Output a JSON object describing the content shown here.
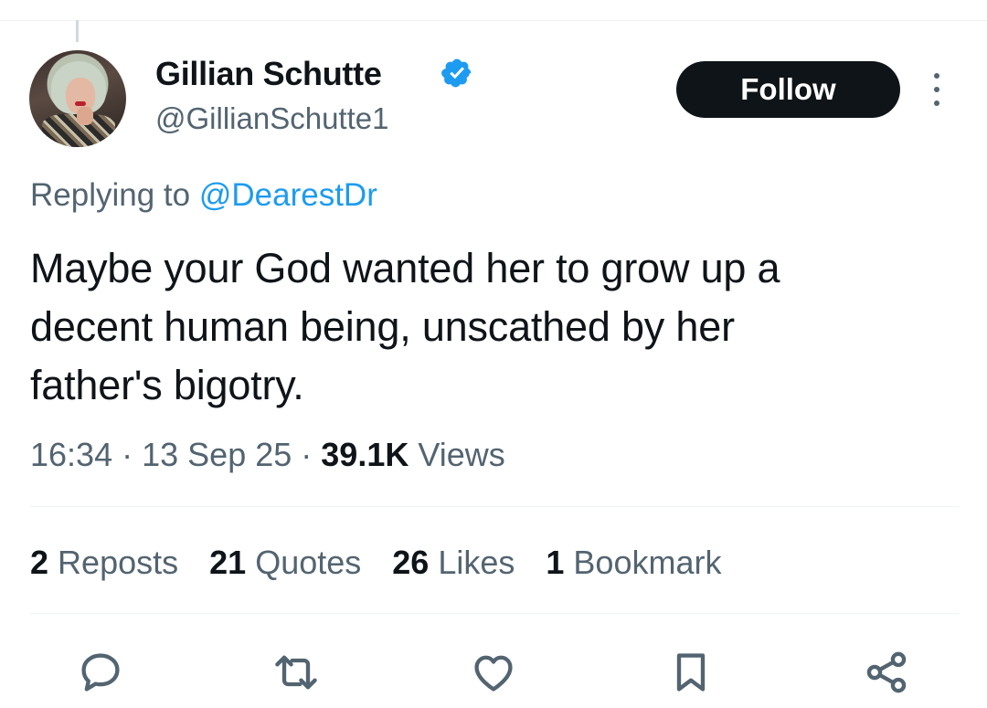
{
  "author": {
    "display_name": "Gillian Schutte",
    "handle": "@GillianSchutte1",
    "verified": true
  },
  "follow_label": "Follow",
  "reply_context": {
    "prefix": "Replying to",
    "mention": "@DearestDr"
  },
  "tweet": {
    "lines": [
      "Maybe your God wanted her to grow up a",
      "decent human being, unscathed by her",
      "father's bigotry."
    ],
    "time": "16:34",
    "date": "13 Sep 25",
    "views_count": "39.1K",
    "views_label": "Views"
  },
  "stats": {
    "reposts": {
      "count": "2",
      "label": "Reposts"
    },
    "quotes": {
      "count": "21",
      "label": "Quotes"
    },
    "likes": {
      "count": "26",
      "label": "Likes"
    },
    "bookmarks": {
      "count": "1",
      "label": "Bookmark"
    }
  },
  "icons": {
    "verified": "verified-badge-icon",
    "more": "more-options-icon",
    "reply": "reply-icon",
    "repost": "repost-icon",
    "like": "like-icon",
    "bookmark": "bookmark-icon",
    "share": "share-icon"
  },
  "colors": {
    "accent": "#1d9bf0",
    "text": "#0f1419",
    "secondary": "#536471",
    "follow_bg": "#0f1419"
  }
}
